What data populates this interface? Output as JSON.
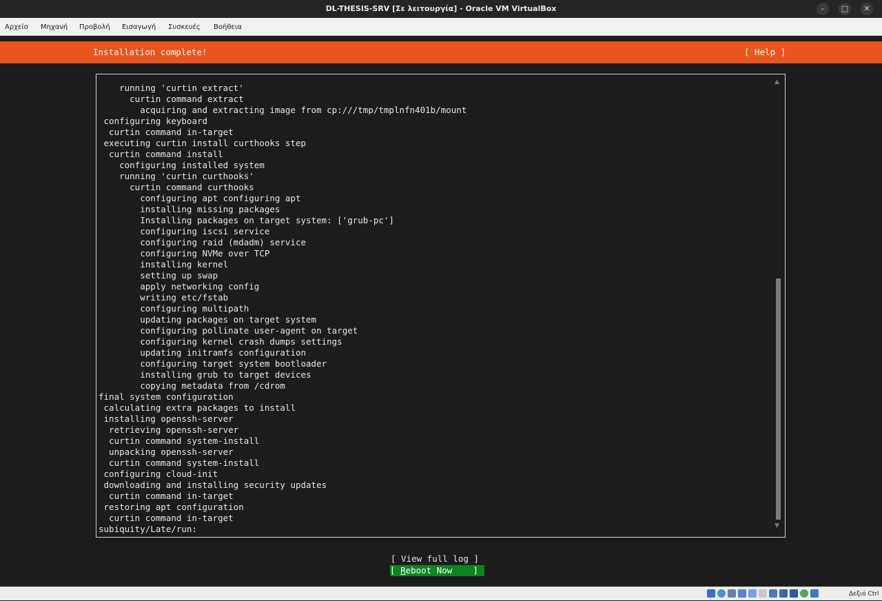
{
  "window": {
    "title": "DL-THESIS-SRV [Σε λειτουργία] - Oracle VM VirtualBox",
    "controls": {
      "minimize": "–",
      "maximize": "□",
      "close": "✕"
    }
  },
  "menu": [
    "Αρχείο",
    "Μηχανή",
    "Προβολή",
    "Εισαγωγή",
    "Συσκευές",
    "Βοήθεια"
  ],
  "installer": {
    "header_title": "Installation complete!",
    "help_label": "[ Help ]",
    "log_lines": [
      "    running 'curtin extract'",
      "      curtin command extract",
      "        acquiring and extracting image from cp:///tmp/tmplnfn401b/mount",
      " configuring keyboard",
      "  curtin command in-target",
      " executing curtin install curthooks step",
      "  curtin command install",
      "    configuring installed system",
      "    running 'curtin curthooks'",
      "      curtin command curthooks",
      "        configuring apt configuring apt",
      "        installing missing packages",
      "        Installing packages on target system: ['grub-pc']",
      "        configuring iscsi service",
      "        configuring raid (mdadm) service",
      "        configuring NVMe over TCP",
      "        installing kernel",
      "        setting up swap",
      "        apply networking config",
      "        writing etc/fstab",
      "        configuring multipath",
      "        updating packages on target system",
      "        configuring pollinate user-agent on target",
      "        configuring kernel crash dumps settings",
      "        updating initramfs configuration",
      "        configuring target system bootloader",
      "        installing grub to target devices",
      "        copying metadata from /cdrom",
      "final system configuration",
      " calculating extra packages to install",
      " installing openssh-server",
      "  retrieving openssh-server",
      "  curtin command system-install",
      "  unpacking openssh-server",
      "  curtin command system-install",
      " configuring cloud-init",
      " downloading and installing security updates",
      "  curtin command in-target",
      " restoring apt configuration",
      "  curtin command in-target",
      "subiquity/Late/run:"
    ],
    "view_log_label": "[ View full log ]",
    "reboot": {
      "open": "[ ",
      "key": "R",
      "rest": "eboot Now",
      "close": "    ]"
    }
  },
  "statusbar": {
    "icons": [
      "hard-disk-icon",
      "optical-drive-icon",
      "audio-icon",
      "network-icon",
      "usb-icon",
      "shared-folders-icon",
      "display-icon",
      "recording-icon",
      "cpu-icon",
      "mouse-integration-icon",
      "keyboard-icon"
    ],
    "host_key": "Δεξιό Ctrl"
  }
}
